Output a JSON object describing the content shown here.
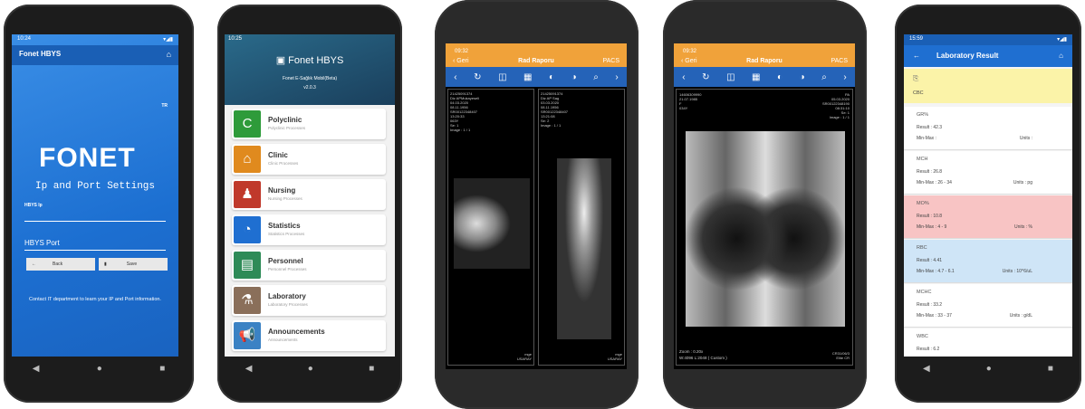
{
  "phone1": {
    "status_time": "10:24",
    "app_title": "Fonet HBYS",
    "tr": "TR",
    "logo": "FONET",
    "heading": "Ip and Port Settings",
    "hbys_ip_label": "HBYS Ip",
    "hbys_port_label": "HBYS Port",
    "back_label": "Back",
    "save_label": "Save",
    "info": "Contact IT department to learn your IP and Port information."
  },
  "phone2": {
    "status_time": "10:25",
    "app_title": "Fonet HBYS",
    "subtitle": "Fonet E-Sağlık Mobil(Beta)",
    "version": "v2.0.3",
    "menu": [
      {
        "title": "Polyclinic",
        "sub": "Polyclinic Processes",
        "color": "#2e9b3a",
        "icon": "C"
      },
      {
        "title": "Clinic",
        "sub": "Clinic Processes",
        "color": "#e08a1e",
        "icon": "⌂"
      },
      {
        "title": "Nursing",
        "sub": "Nursing Processes",
        "color": "#c0392b",
        "icon": "♟"
      },
      {
        "title": "Statistics",
        "sub": "Statistics Processes",
        "color": "#1f6fd1",
        "icon": "◔"
      },
      {
        "title": "Personnel",
        "sub": "Personnel Processes",
        "color": "#2e8b57",
        "icon": "▤"
      },
      {
        "title": "Laboratory",
        "sub": "Laboratory Processes",
        "color": "#8a6f5a",
        "icon": "⚗"
      },
      {
        "title": "Announcements",
        "sub": "Announcements",
        "color": "#3b82c4",
        "icon": "📢"
      }
    ]
  },
  "phone3": {
    "time": "09:32",
    "back": "Geri",
    "title": "Rad Raporu",
    "pacs": "PACS",
    "left_info": "21425091374\nDiz APMukayeseli\n04.03.2020\n08.11.1956\nSR00122348407\n13:20:33\n063Y\nSe: 1\nImage : 1 / 1",
    "right_info": "21425091374\nDiz AP Sag\n03.03.2020\n08.11.1956\nSR00122348407\n13:21:08\nSe: 2\nImage : 1 / 1",
    "footer_left": "mge\nUSARAY",
    "footer_right": "mge\nUSARAY"
  },
  "phone4": {
    "time": "09:32",
    "back": "Geri",
    "title": "Rad Raporu",
    "pacs": "PACS",
    "info_left": "14606309990\n21.07.1985\nF\n034Y",
    "info_right": "PA\n05.03.2020\nSR00122348190\n08:31:10\nSe: 1\nImage : 1 / 1",
    "zoom": "Zoom : 0.20x",
    "wl": "W:4096 L:2048 ( Custom )",
    "footer_right": "CR31/06/3\nElite CR"
  },
  "phone5": {
    "status_time": "15:59",
    "title": "Laboratory Result",
    "cbc": "CBC",
    "results": [
      {
        "name": "GR%",
        "result": "Result : 42.3",
        "minmax": "Min-Max :",
        "units": "Units :",
        "bg": "#ffffff"
      },
      {
        "name": "MCH",
        "result": "Result : 26.8",
        "minmax": "Min-Max : 26 - 34",
        "units": "Units : pg",
        "bg": "#ffffff"
      },
      {
        "name": "MO%",
        "result": "Result : 10.8",
        "minmax": "Min-Max : 4 - 9",
        "units": "Units : %",
        "bg": "#f8c4c4"
      },
      {
        "name": "RBC",
        "result": "Result : 4.41",
        "minmax": "Min-Max : 4.7 - 6.1",
        "units": "Units : 10^6/uL",
        "bg": "#cfe5f7"
      },
      {
        "name": "MCHC",
        "result": "Result : 33.2",
        "minmax": "Min-Max : 33 - 37",
        "units": "Units : g/dL",
        "bg": "#ffffff"
      },
      {
        "name": "WBC",
        "result": "Result : 6.2",
        "minmax": "",
        "units": "",
        "bg": "#ffffff"
      }
    ]
  },
  "nav": {
    "back": "◀",
    "home": "●",
    "recent": "■"
  }
}
